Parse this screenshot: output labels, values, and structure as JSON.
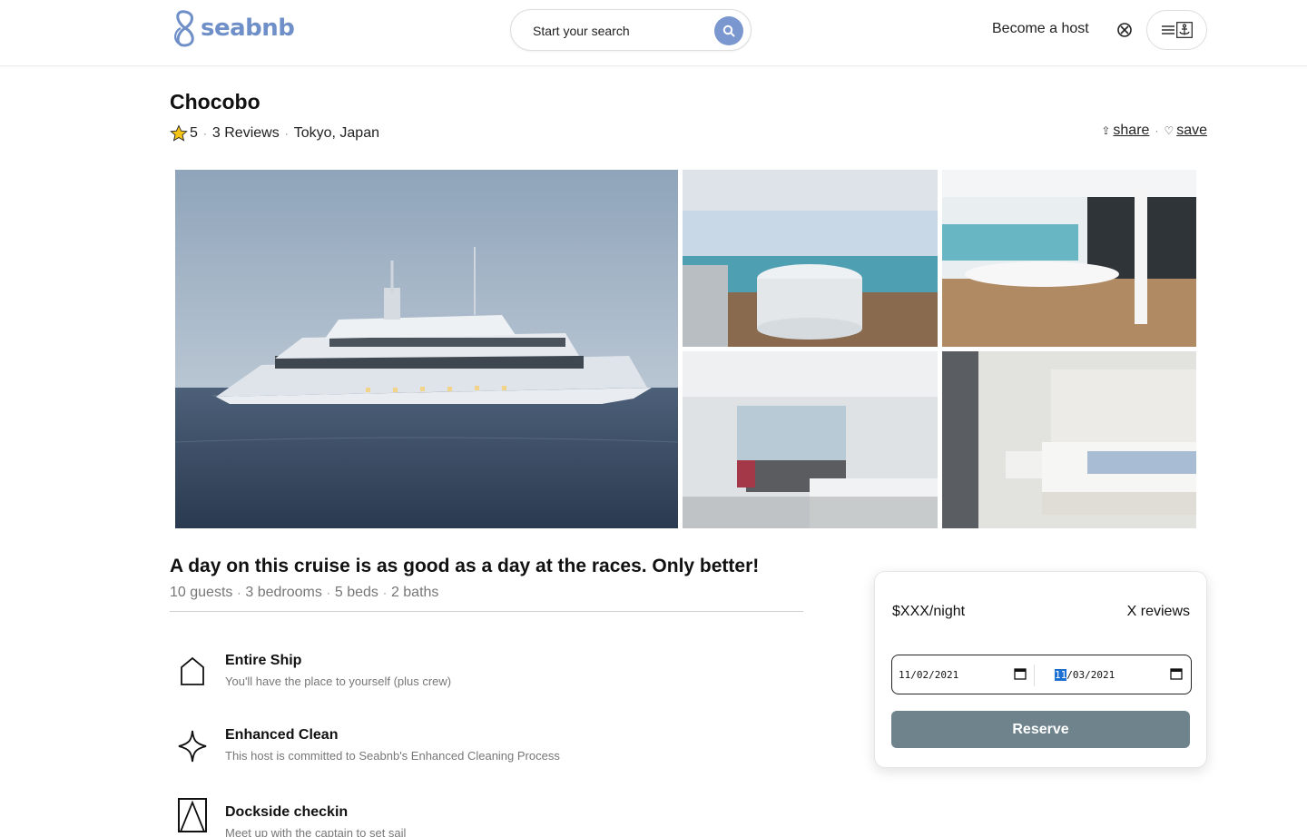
{
  "header": {
    "logo_text": "seabnb",
    "search_placeholder": "Start your search",
    "become_host": "Become a host"
  },
  "listing": {
    "title": "Chocobo",
    "rating": "5",
    "reviews_link": "3 Reviews",
    "location": "Tokyo, Japan",
    "share": "share",
    "save": "save"
  },
  "details": {
    "headline": "A day on this cruise is as good as a day at the races. Only better!",
    "facts": [
      "10 guests",
      "3 bedrooms",
      "5 beds",
      "2 baths"
    ],
    "features": [
      {
        "title": "Entire Ship",
        "desc": "You'll have the place to yourself (plus crew)",
        "icon": "house-icon"
      },
      {
        "title": "Enhanced Clean",
        "desc": "This host is committed to Seabnb's Enhanced Cleaning Process",
        "icon": "sparkle-icon"
      },
      {
        "title": "Dockside checkin",
        "desc": "Meet up with the captain to set sail",
        "icon": "door-icon"
      }
    ]
  },
  "booking": {
    "price": "$XXX/night",
    "reviews": "X reviews",
    "checkin": {
      "mm": "11",
      "dd": "02",
      "yyyy": "2021"
    },
    "checkout": {
      "mm": "11",
      "dd": "03",
      "yyyy": "2021"
    },
    "reserve": "Reserve"
  },
  "colors": {
    "brand": "#6f8fc9",
    "reserve_button": "#6f838d",
    "selection_highlight": "#1a6fd1"
  }
}
